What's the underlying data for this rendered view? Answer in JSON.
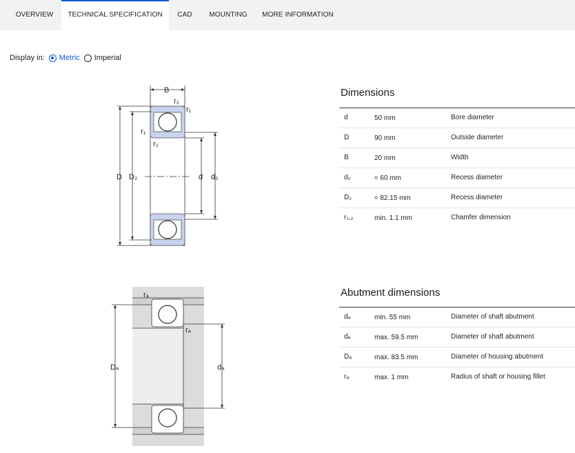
{
  "tabs": [
    {
      "label": "OVERVIEW"
    },
    {
      "label": "TECHNICAL SPECIFICATION"
    },
    {
      "label": "CAD"
    },
    {
      "label": "MOUNTING"
    },
    {
      "label": "MORE INFORMATION"
    }
  ],
  "active_tab": "TECHNICAL SPECIFICATION",
  "display": {
    "label": "Display in:",
    "options": [
      {
        "label": "Metric",
        "selected": true
      },
      {
        "label": "Imperial",
        "selected": false
      }
    ]
  },
  "dimensions": {
    "title": "Dimensions",
    "rows": [
      {
        "symbol": "d",
        "value": "50 mm",
        "description": "Bore diameter"
      },
      {
        "symbol": "D",
        "value": "90 mm",
        "description": "Outside diameter"
      },
      {
        "symbol": "B",
        "value": "20 mm",
        "description": "Width"
      },
      {
        "symbol": "d₂",
        "value": "≈ 60 mm",
        "description": "Recess diameter"
      },
      {
        "symbol": "D₂",
        "value": "≈ 82.15 mm",
        "description": "Recess diameter"
      },
      {
        "symbol": "r₁,₂",
        "value": "min. 1.1 mm",
        "description": "Chamfer dimension"
      }
    ]
  },
  "abutment": {
    "title": "Abutment dimensions",
    "rows": [
      {
        "symbol": "dₐ",
        "value": "min. 55 mm",
        "description": "Diameter of shaft abutment"
      },
      {
        "symbol": "dₐ",
        "value": "max. 59.5 mm",
        "description": "Diameter of shaft abutment"
      },
      {
        "symbol": "Dₐ",
        "value": "max. 83.5 mm",
        "description": "Diameter of housing abutment"
      },
      {
        "symbol": "rₐ",
        "value": "max. 1 mm",
        "description": "Radius of shaft or housing fillet"
      }
    ]
  },
  "drawing_labels": {
    "B": "B",
    "r1": "r₁",
    "r2": "r₂",
    "D": "D",
    "D2": "D₂",
    "d": "d",
    "d2": "d₂",
    "ra": "rₐ",
    "Da": "Dₐ",
    "da": "dₐ"
  },
  "colors": {
    "accent": "#0f58d6",
    "ring_fill": "#c8d3ee",
    "housing_fill": "#d9d9d9"
  }
}
